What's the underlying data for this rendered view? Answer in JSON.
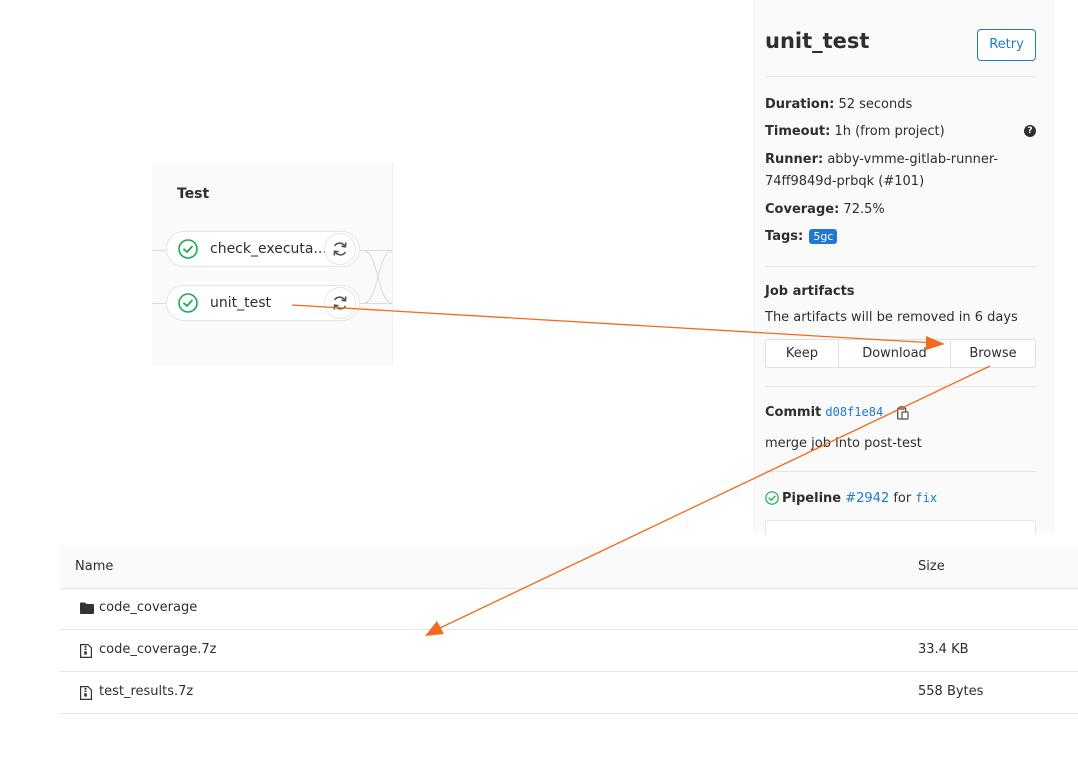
{
  "pipeline_graph": {
    "stage_title": "Test",
    "jobs": [
      {
        "name": "check_executa...",
        "status": "passed"
      },
      {
        "name": "unit_test",
        "status": "passed"
      }
    ]
  },
  "job_sidebar": {
    "title": "unit_test",
    "retry_label": "Retry",
    "duration_label": "Duration:",
    "duration_value": "52 seconds",
    "timeout_label": "Timeout:",
    "timeout_value": "1h (from project)",
    "runner_label": "Runner:",
    "runner_value_line1": "abby-vmme-gitlab-runner-",
    "runner_value_line2": "74ff9849d-prbqk (#101)",
    "coverage_label": "Coverage:",
    "coverage_value": "72.5%",
    "tags_label": "Tags:",
    "tag": "5gc",
    "artifacts_title": "Job artifacts",
    "artifacts_note": "The artifacts will be removed in 6 days",
    "buttons": {
      "keep": "Keep",
      "download": "Download",
      "browse": "Browse"
    },
    "commit_label": "Commit",
    "commit_sha": "d08f1e84",
    "commit_message": "merge job into post-test",
    "pipeline_label": "Pipeline",
    "pipeline_id": "#2942",
    "pipeline_for": "for",
    "pipeline_ref": "fix"
  },
  "artifact_browser": {
    "columns": {
      "name": "Name",
      "size": "Size"
    },
    "rows": [
      {
        "name": "code_coverage",
        "type": "folder",
        "size": ""
      },
      {
        "name": "code_coverage.7z",
        "type": "file",
        "size": "33.4 KB"
      },
      {
        "name": "test_results.7z",
        "type": "file",
        "size": "558 Bytes"
      }
    ]
  },
  "colors": {
    "success": "#1aaa55",
    "link": "#1f78d1",
    "annotation_arrow": "#f26b1d"
  }
}
